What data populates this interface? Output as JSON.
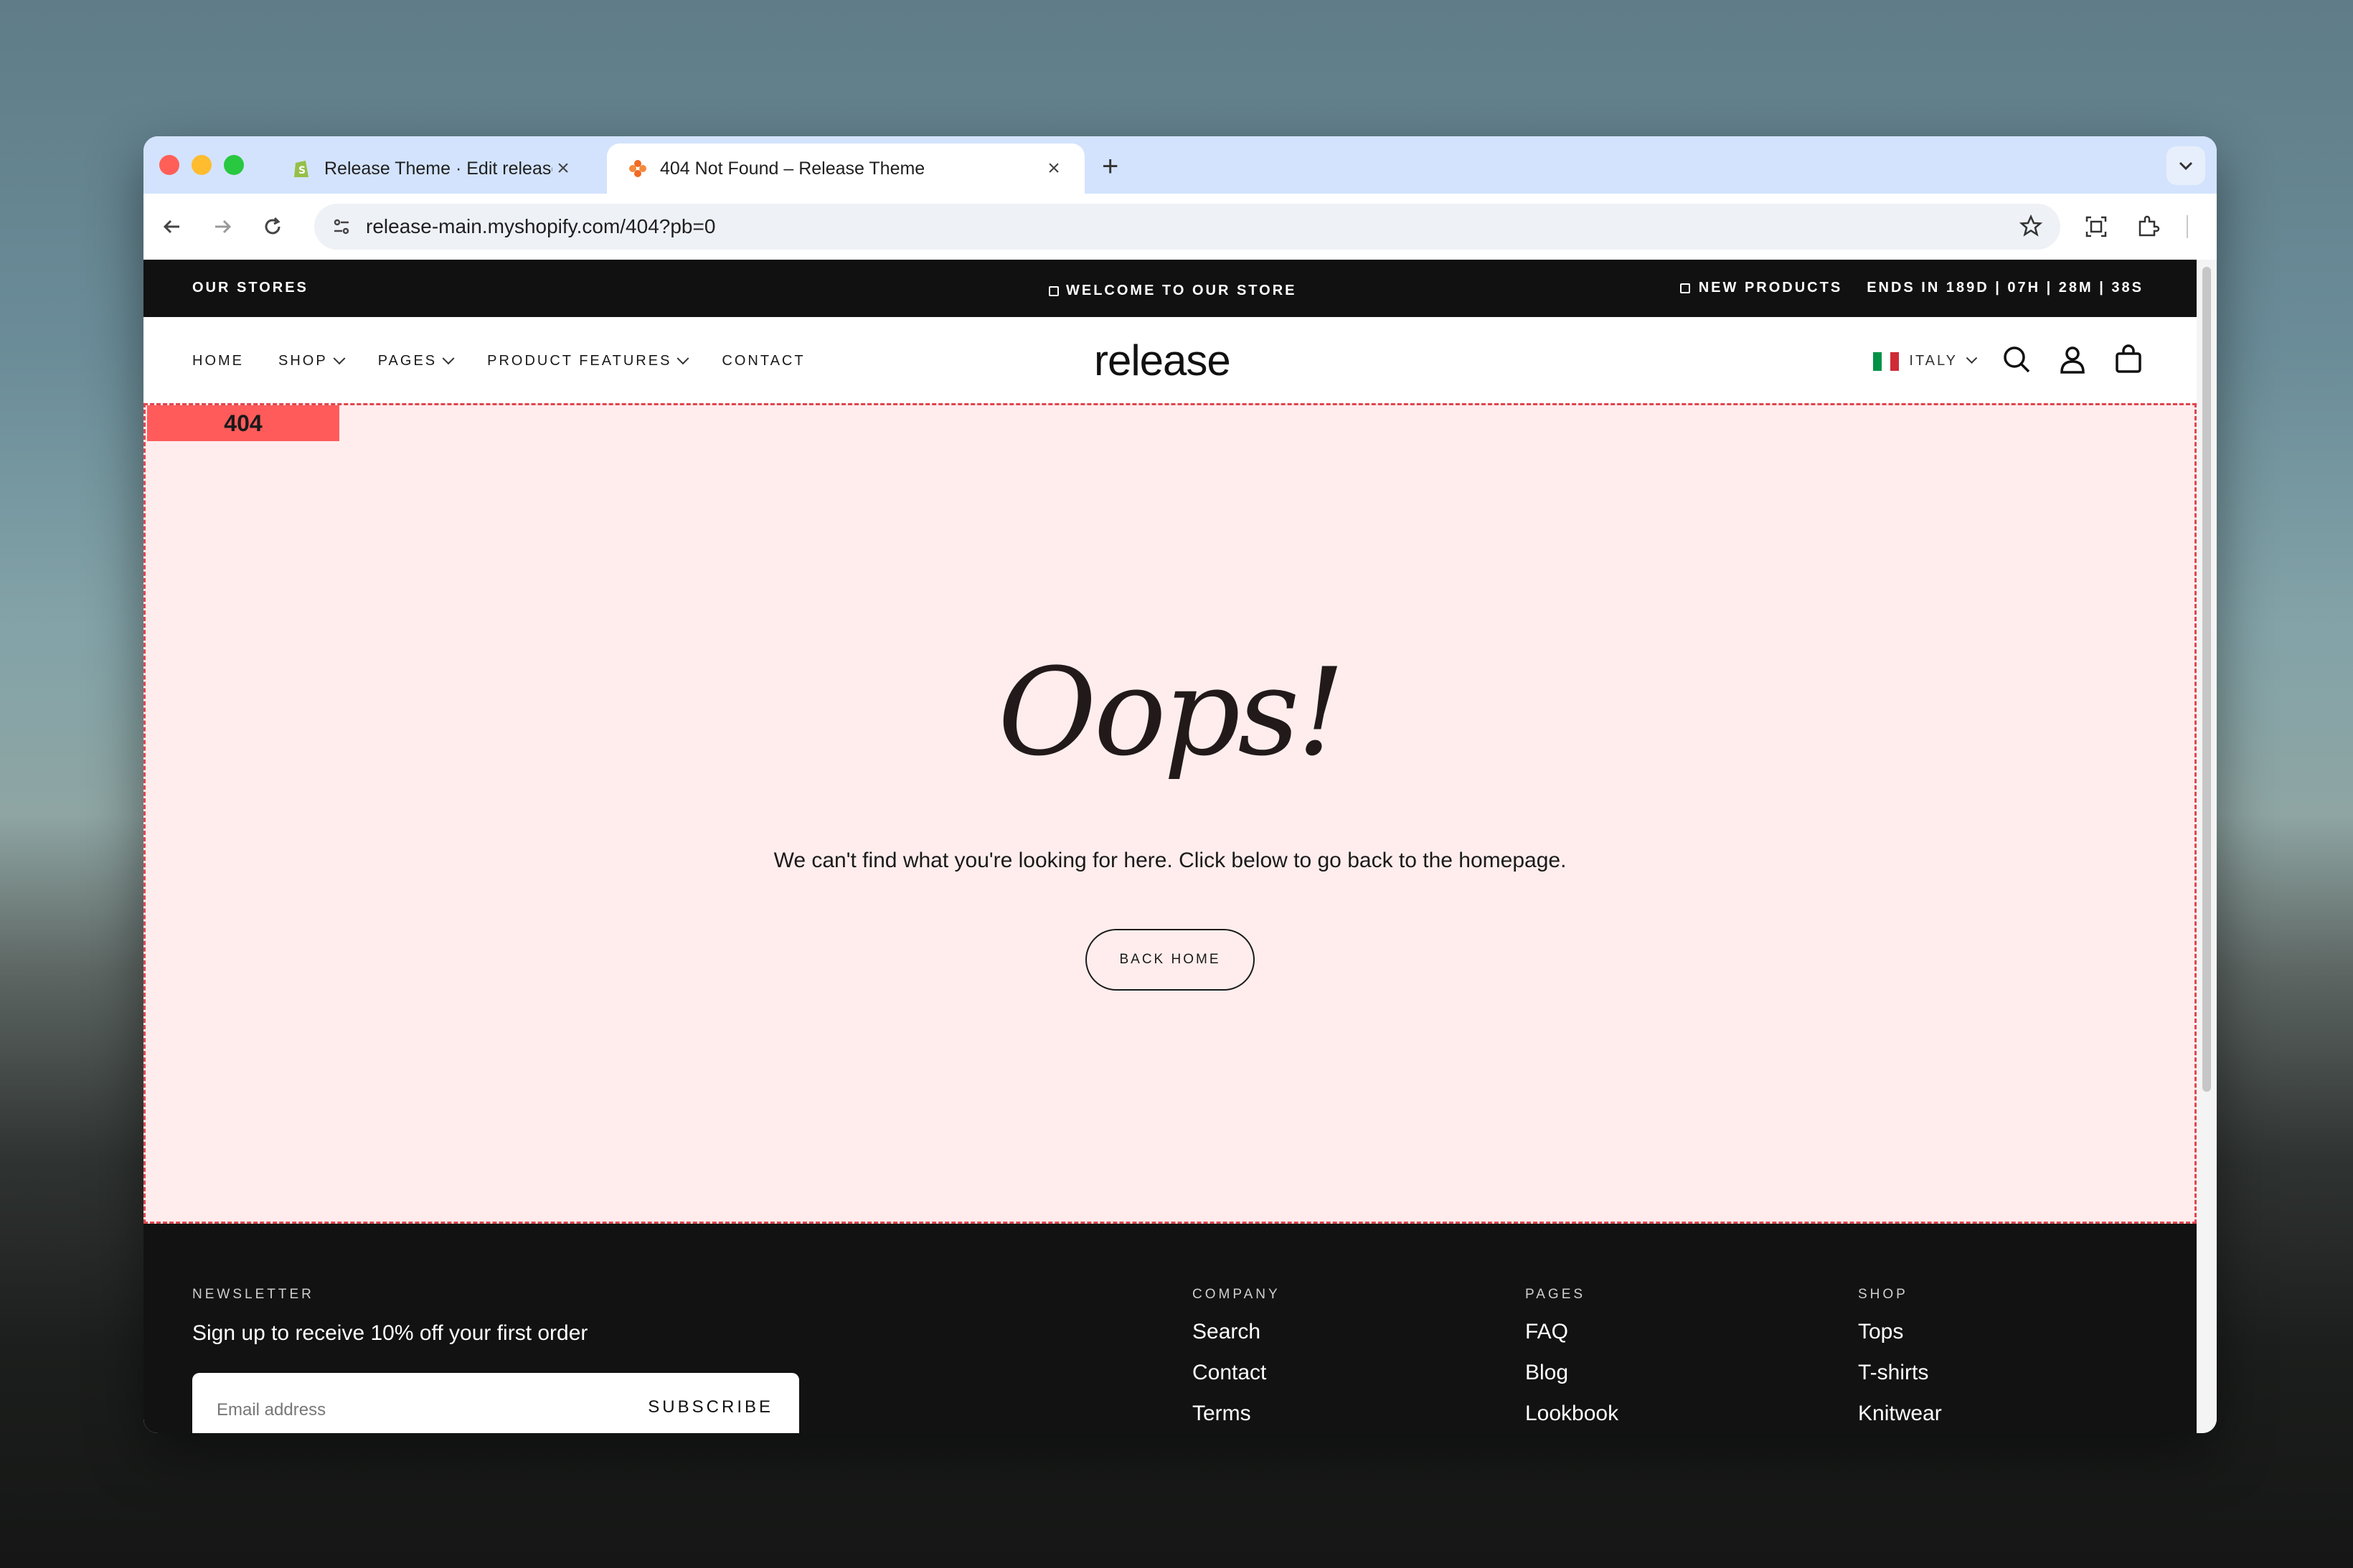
{
  "browser": {
    "tabs": [
      {
        "title": "Release Theme · Edit release",
        "active": false
      },
      {
        "title": "404 Not Found – Release Theme",
        "active": true
      }
    ],
    "url": "release-main.myshopify.com/404?pb=0"
  },
  "announcement": {
    "left": "OUR STORES",
    "center": "WELCOME TO OUR STORE",
    "right_label": "NEW PRODUCTS",
    "countdown": "ENDS IN 189D | 07H | 28M | 38S"
  },
  "header": {
    "nav": [
      "HOME",
      "SHOP",
      "PAGES",
      "PRODUCT FEATURES",
      "CONTACT"
    ],
    "logo": "release",
    "country": "ITALY"
  },
  "section": {
    "tag": "404",
    "heading": "Oops!",
    "message": "We can't find what you're looking for here. Click below to go back to the homepage.",
    "button": "BACK HOME"
  },
  "footer": {
    "newsletter_heading": "NEWSLETTER",
    "newsletter_text": "Sign up to receive 10% off your first order",
    "email_placeholder": "Email address",
    "subscribe": "SUBSCRIBE",
    "columns": [
      {
        "heading": "COMPANY",
        "links": [
          "Search",
          "Contact",
          "Terms"
        ]
      },
      {
        "heading": "PAGES",
        "links": [
          "FAQ",
          "Blog",
          "Lookbook"
        ]
      },
      {
        "heading": "SHOP",
        "links": [
          "Tops",
          "T-shirts",
          "Knitwear"
        ]
      }
    ]
  },
  "colors": {
    "section_bg": "#ffeded",
    "dashed_border": "#e0464e",
    "tag_bg": "#ff5b5b",
    "footer_bg": "#121212",
    "announcement_bg": "#111111"
  }
}
